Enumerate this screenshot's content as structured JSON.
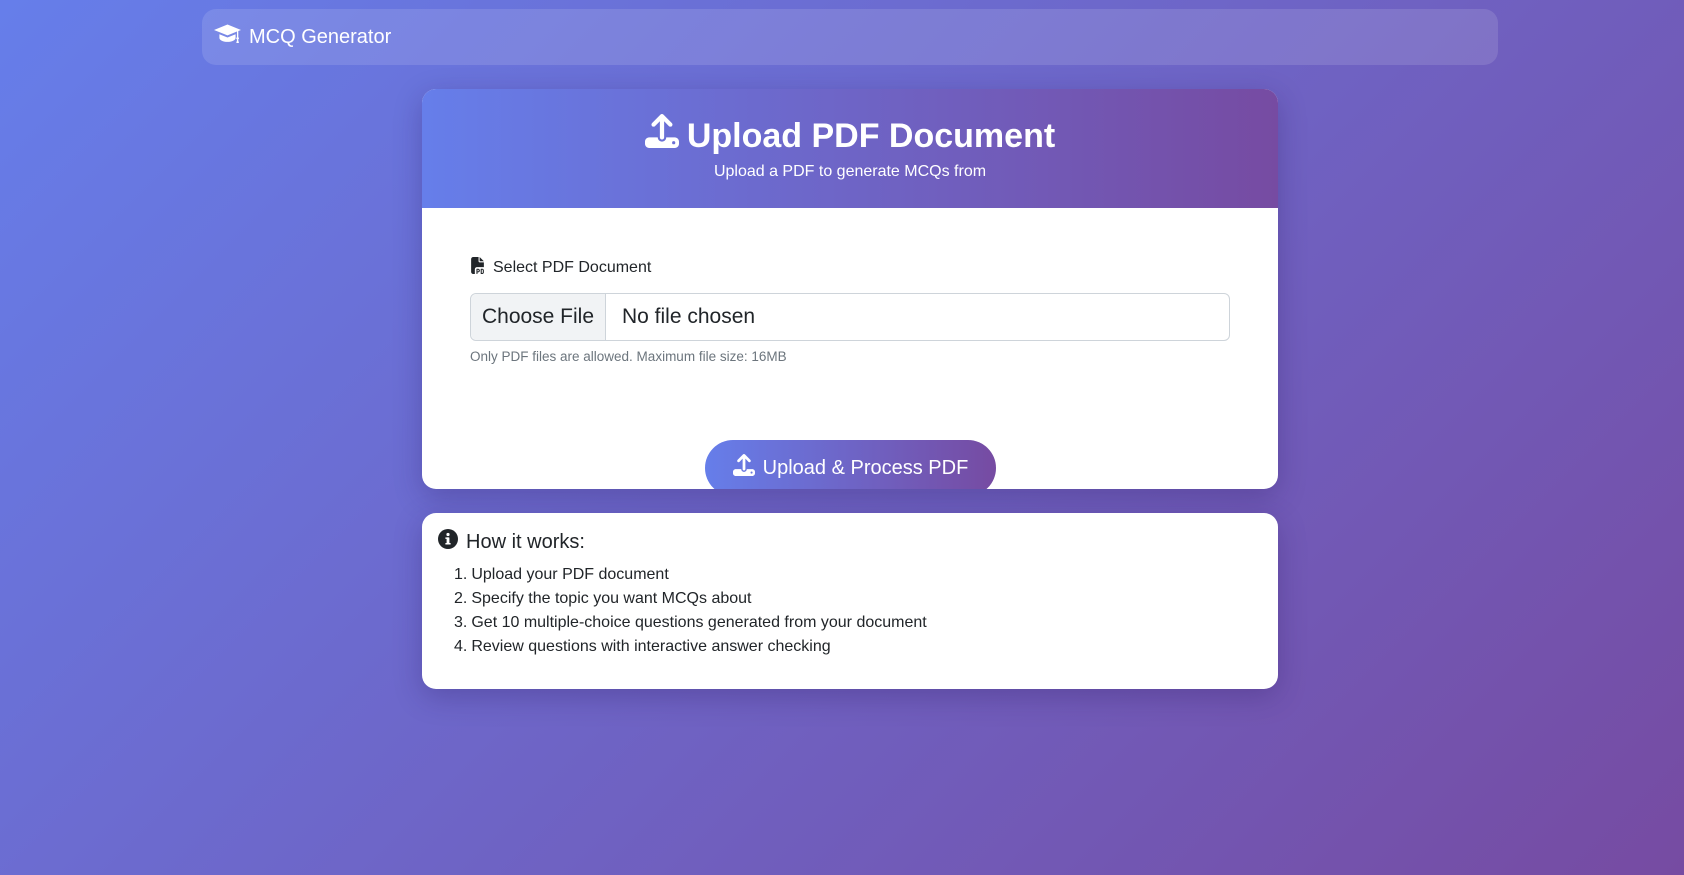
{
  "navbar": {
    "brand_icon": "graduation-cap-icon",
    "brand_label": "MCQ Generator"
  },
  "upload_card": {
    "header_icon": "upload-icon",
    "title": "Upload PDF Document",
    "subtitle": "Upload a PDF to generate MCQs from",
    "field_icon": "file-pdf-icon",
    "field_label": "Select PDF Document",
    "choose_file_label": "Choose File",
    "file_status": "No file chosen",
    "help_text": "Only PDF files are allowed. Maximum file size: 16MB",
    "submit_icon": "upload-icon",
    "submit_label": "Upload & Process PDF"
  },
  "info_card": {
    "icon": "info-circle-icon",
    "title": "How it works:",
    "steps": [
      {
        "num": "1.",
        "text": "Upload your PDF document"
      },
      {
        "num": "2.",
        "text": "Specify the topic you want MCQs about"
      },
      {
        "num": "3.",
        "text": "Get 10 multiple-choice questions generated from your document"
      },
      {
        "num": "4.",
        "text": "Review questions with interactive answer checking"
      }
    ]
  },
  "colors": {
    "gradient_start": "#667eea",
    "gradient_end": "#764ba2",
    "card_background": "#ffffff",
    "help_text": "#6c757d"
  }
}
